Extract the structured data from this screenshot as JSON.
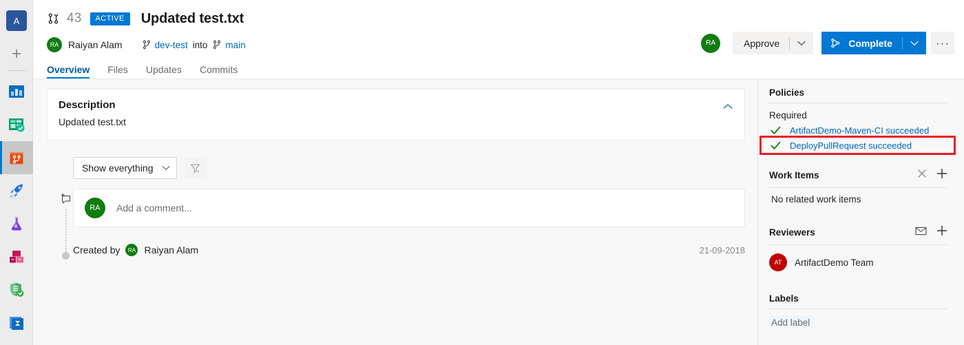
{
  "rail": {
    "org_initial": "A",
    "items": [
      {
        "name": "organization-badge",
        "label": "A"
      },
      {
        "name": "new-project",
        "label": "+"
      },
      {
        "name": "overview-icon",
        "label": "Overview"
      },
      {
        "name": "boards-icon",
        "label": "Boards"
      },
      {
        "name": "repos-icon",
        "label": "Repos"
      },
      {
        "name": "pipelines-icon",
        "label": "Pipelines"
      },
      {
        "name": "test-plans-icon",
        "label": "Test Plans"
      },
      {
        "name": "artifacts-icon",
        "label": "Artifacts"
      },
      {
        "name": "security-icon",
        "label": "Security"
      },
      {
        "name": "analytics-icon",
        "label": "Analytics"
      }
    ]
  },
  "pr": {
    "icon": "pull-request-icon",
    "number": "43",
    "status": "ACTIVE",
    "title": "Updated test.txt",
    "author": {
      "initials": "RA",
      "name": "Raiyan Alam",
      "color": "#107c10"
    },
    "source_branch": "dev-test",
    "into_label": "into",
    "target_branch": "main",
    "tabs": [
      {
        "label": "Overview",
        "active": true
      },
      {
        "label": "Files",
        "active": false
      },
      {
        "label": "Updates",
        "active": false
      },
      {
        "label": "Commits",
        "active": false
      }
    ]
  },
  "actions": {
    "user_avatar": {
      "initials": "RA",
      "color": "#107c10"
    },
    "approve_label": "Approve",
    "complete_label": "Complete",
    "more_label": "···"
  },
  "description": {
    "title": "Description",
    "text": "Updated test.txt",
    "collapse_icon": "chevron-up-icon"
  },
  "filters": {
    "show_label": "Show everything",
    "clear_filter_icon": "filter-clear-icon"
  },
  "thread": {
    "add_comment_icon": "add-comment-icon",
    "comment_avatar": {
      "initials": "RA",
      "color": "#107c10"
    },
    "comment_placeholder": "Add a comment...",
    "created_by_label": "Created by",
    "created_by_avatar": {
      "initials": "RA",
      "color": "#107c10"
    },
    "created_by_name": "Raiyan Alam",
    "created_date": "21-09-2018"
  },
  "policies": {
    "title": "Policies",
    "required_label": "Required",
    "items": [
      {
        "label": "ArtifactDemo-Maven-CI succeeded",
        "state": "succeeded",
        "highlighted": false
      },
      {
        "label": "DeployPullRequest succeeded",
        "state": "succeeded",
        "highlighted": true
      }
    ],
    "check_color": "#107c10",
    "highlight_color": "#ec1c24"
  },
  "work_items": {
    "title": "Work Items",
    "empty_text": "No related work items",
    "close_icon": "close-icon",
    "add_icon": "plus-icon"
  },
  "reviewers": {
    "title": "Reviewers",
    "mail_icon": "mail-icon",
    "add_icon": "plus-icon",
    "list": [
      {
        "initials": "AT",
        "name": "ArtifactDemo Team",
        "color": "#c00000"
      }
    ]
  },
  "labels": {
    "title": "Labels",
    "add_label": "Add label"
  }
}
